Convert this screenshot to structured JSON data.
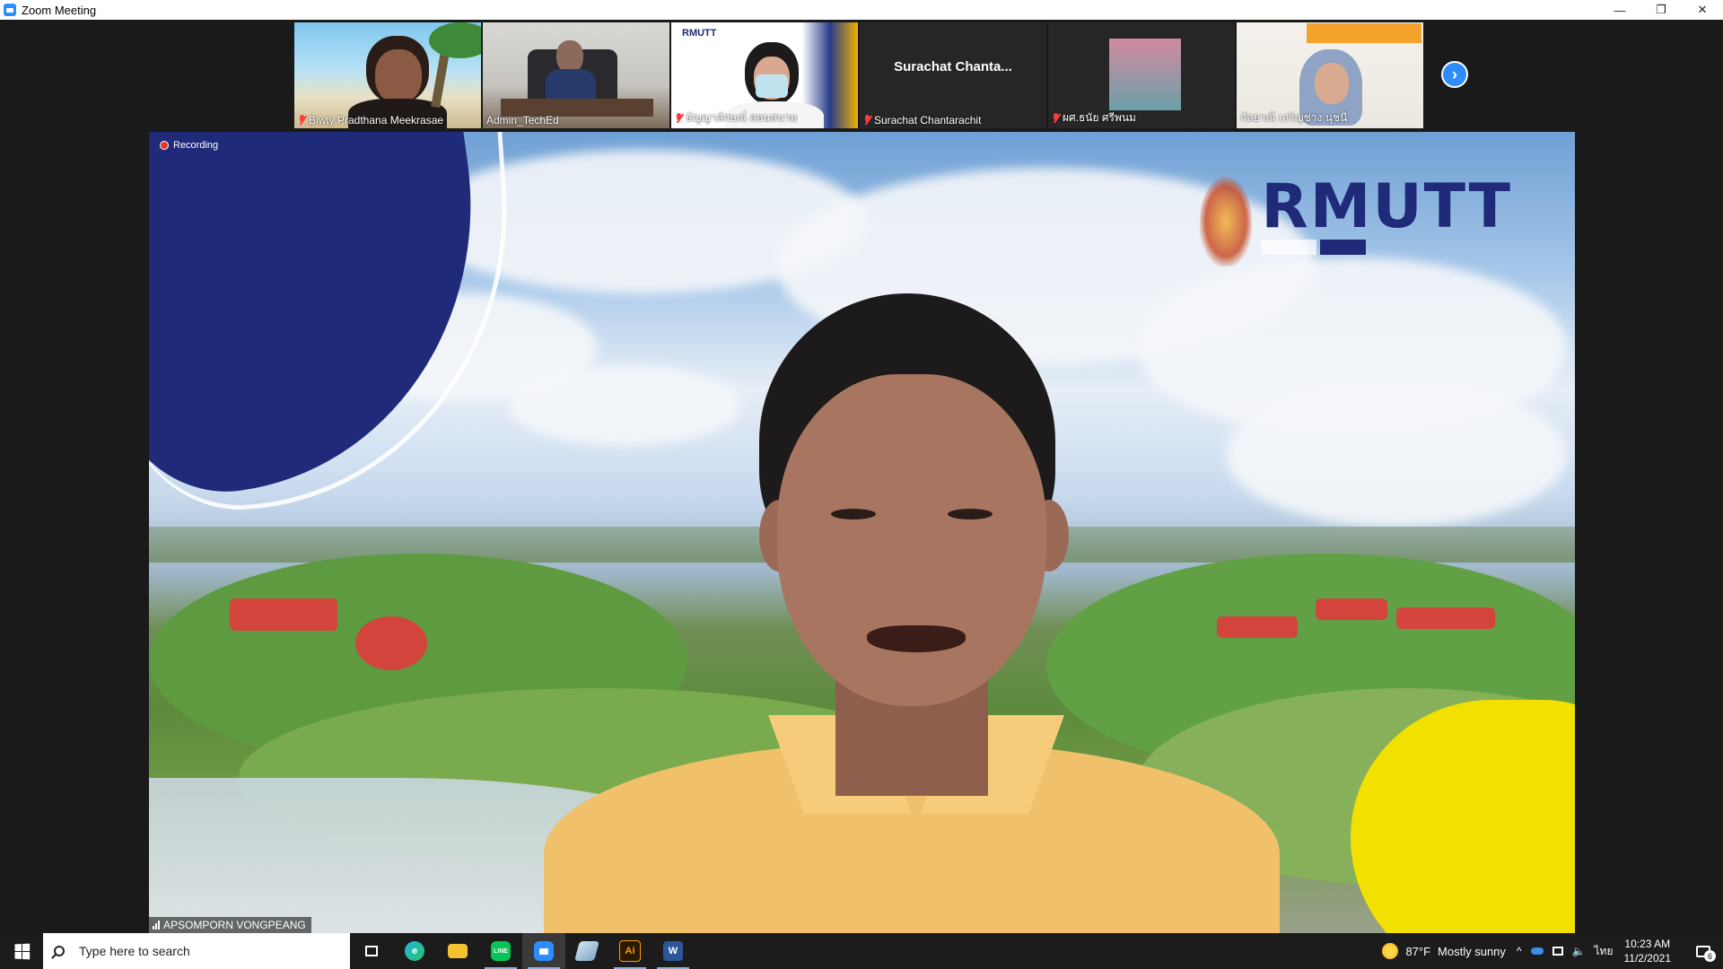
{
  "window": {
    "title": "Zoom Meeting",
    "controls": {
      "minimize": "—",
      "restore": "❐",
      "close": "✕"
    }
  },
  "gallery": {
    "participants": [
      {
        "name": "Biwty Pradthana Meekrasae",
        "muted": true,
        "video": "beach"
      },
      {
        "name": "Admin_TechEd",
        "muted": false,
        "video": "office"
      },
      {
        "name": "ธัญญาลักษณ์ สอนสนาม",
        "muted": true,
        "video": "white"
      },
      {
        "name": "Surachat Chantarachit",
        "display_name": "Surachat  Chanta...",
        "muted": true,
        "video": "none"
      },
      {
        "name": "ผศ.ธนัย  ศรีพนม",
        "muted": true,
        "video": "dark"
      },
      {
        "name": "กัลยาณี เจริญช่าง นุชนี",
        "muted": false,
        "video": "brick"
      }
    ],
    "next_icon": "chevron-right-icon"
  },
  "main_video": {
    "recording_label": "Recording",
    "speaker_name": "APSOMPORN VONGPEANG",
    "logo_text": "RMUTT"
  },
  "taskbar": {
    "search_placeholder": "Type here to search",
    "apps": [
      {
        "name": "task-view",
        "label": ""
      },
      {
        "name": "edge",
        "label": "e"
      },
      {
        "name": "file-explorer",
        "label": ""
      },
      {
        "name": "line",
        "label": "LINE"
      },
      {
        "name": "zoom",
        "label": ""
      },
      {
        "name": "app",
        "label": ""
      },
      {
        "name": "illustrator",
        "label": "Ai"
      },
      {
        "name": "word",
        "label": "W"
      }
    ],
    "weather": {
      "temp": "87°F",
      "condition": "Mostly sunny"
    },
    "language": "ไทย",
    "time": "10:23 AM",
    "date": "11/2/2021",
    "notification_count": "6"
  },
  "colors": {
    "zoom_blue": "#2D8CFF",
    "recording_red": "#e5322d",
    "muted_red": "#ff3b3b",
    "taskbar": "#1c1c1c"
  }
}
